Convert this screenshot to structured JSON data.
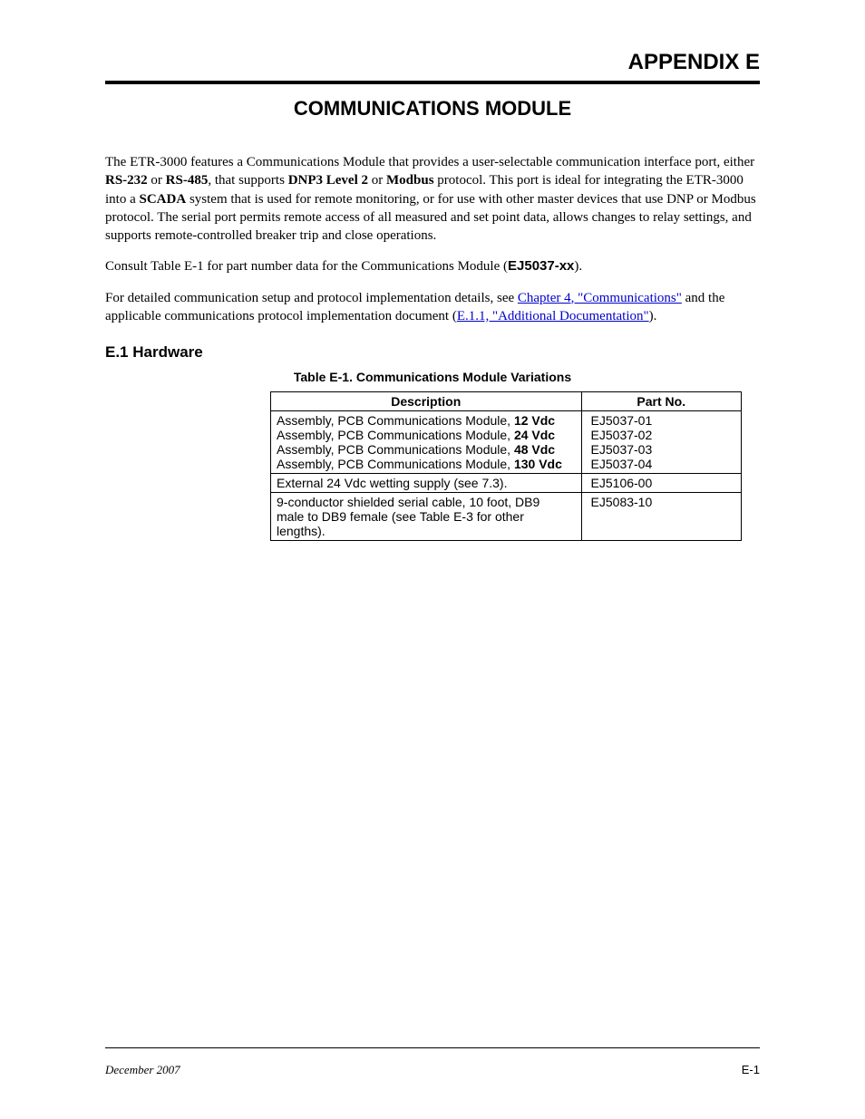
{
  "header": {
    "appendix": "APPENDIX E",
    "module_title": "COMMUNICATIONS MODULE"
  },
  "intro": {
    "p1_pre": "The ETR-3000 features a Communications Module that provides a user-selectable communication interface port, either ",
    "rs232": "RS-232",
    "p1_or": " or ",
    "rs485": "RS-485",
    "p1_mid": ", that supports ",
    "dnp3": "DNP3",
    "level2": " Level 2",
    "p1_or2": " or ",
    "modbus": "Modbus",
    "p1_post1": " protocol. This port is ideal for integrating the ETR-3000 into a ",
    "scada": "SCADA",
    "p1_post2": " system that is used for remote monitoring, or for use with other master devices that use DNP or Modbus protocol. The serial port permits remote access of all measured and set point data, allows changes to relay settings, and supports remote-controlled breaker trip and close operations.",
    "p2_pre": "Consult Table E-1 for part number data for the Communications Module (",
    "partno": "EJ5037-xx",
    "p2_post": ").",
    "p3_pre": "For detailed communication setup and protocol implementation details, see ",
    "link_e1": "Chapter 4, \"Communications\"",
    "p3_mid": " and the applicable communications protocol implementation document (",
    "link_e2": "E.1.1, \"Additional Documentation\"",
    "p3_post": ")."
  },
  "hardware": {
    "heading": "E.1 Hardware"
  },
  "table": {
    "caption": "Table E-1. Communications Module Variations",
    "headers": {
      "desc": "Description",
      "part": "Part No."
    },
    "rows": [
      {
        "desc_lines": [
          {
            "pre": "Assembly, PCB Communications Module,   ",
            "volt": "12 Vdc"
          },
          {
            "pre": "Assembly, PCB Communications Module,   ",
            "volt": "24 Vdc"
          },
          {
            "pre": "Assembly, PCB Communications Module,   ",
            "volt": "48 Vdc"
          },
          {
            "pre": "Assembly, PCB Communications Module, ",
            "volt": "130 Vdc"
          }
        ],
        "parts": [
          "EJ5037-01",
          "EJ5037-02",
          "EJ5037-03",
          "EJ5037-04"
        ]
      },
      {
        "desc_plain": "External 24 Vdc wetting supply (see 7.3).",
        "parts_plain": "EJ5106-00"
      },
      {
        "desc_multiline": [
          "9-conductor shielded serial cable, 10 foot, DB9",
          "male to DB9 female (see Table E-3 for other",
          "lengths)."
        ],
        "parts_plain": "EJ5083-10"
      }
    ]
  },
  "footer": {
    "left": "December 2007",
    "right": "E-1"
  }
}
